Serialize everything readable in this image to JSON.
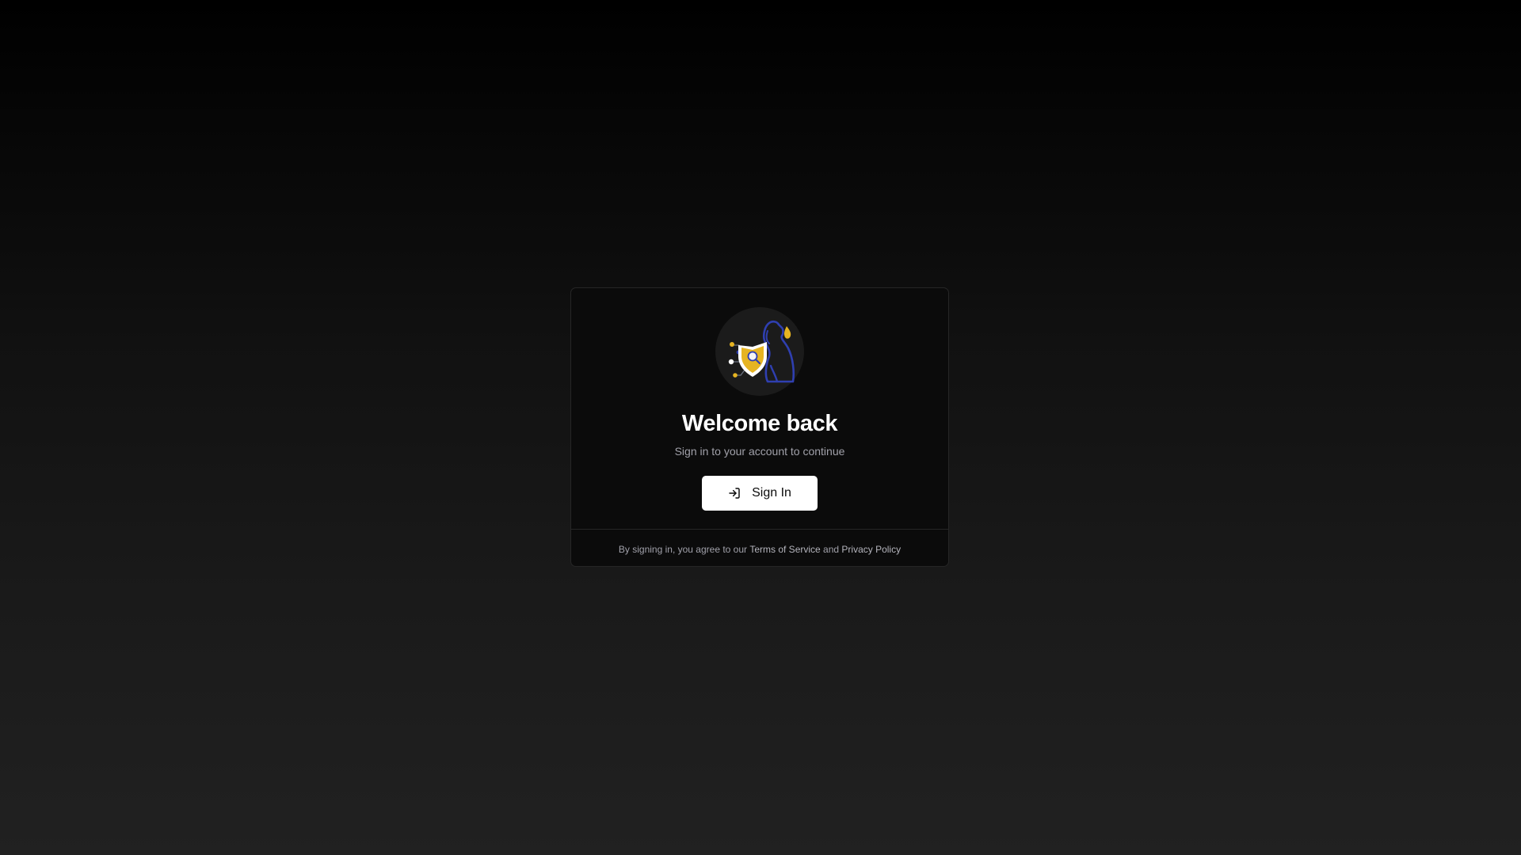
{
  "login": {
    "logo_icon": "shield-dog-logo-icon",
    "title": "Welcome back",
    "subtitle": "Sign in to your account to continue",
    "signin_button": {
      "label": "Sign In",
      "icon": "log-in-icon"
    },
    "footer": {
      "prefix": "By signing in, you agree to our ",
      "terms_label": "Terms of Service",
      "joiner": " and ",
      "privacy_label": "Privacy Policy"
    }
  },
  "colors": {
    "accent_gold": "#e6b422",
    "accent_blue": "#2f3fb0",
    "card_bg": "#0b0b0b",
    "button_bg": "#ffffff"
  }
}
